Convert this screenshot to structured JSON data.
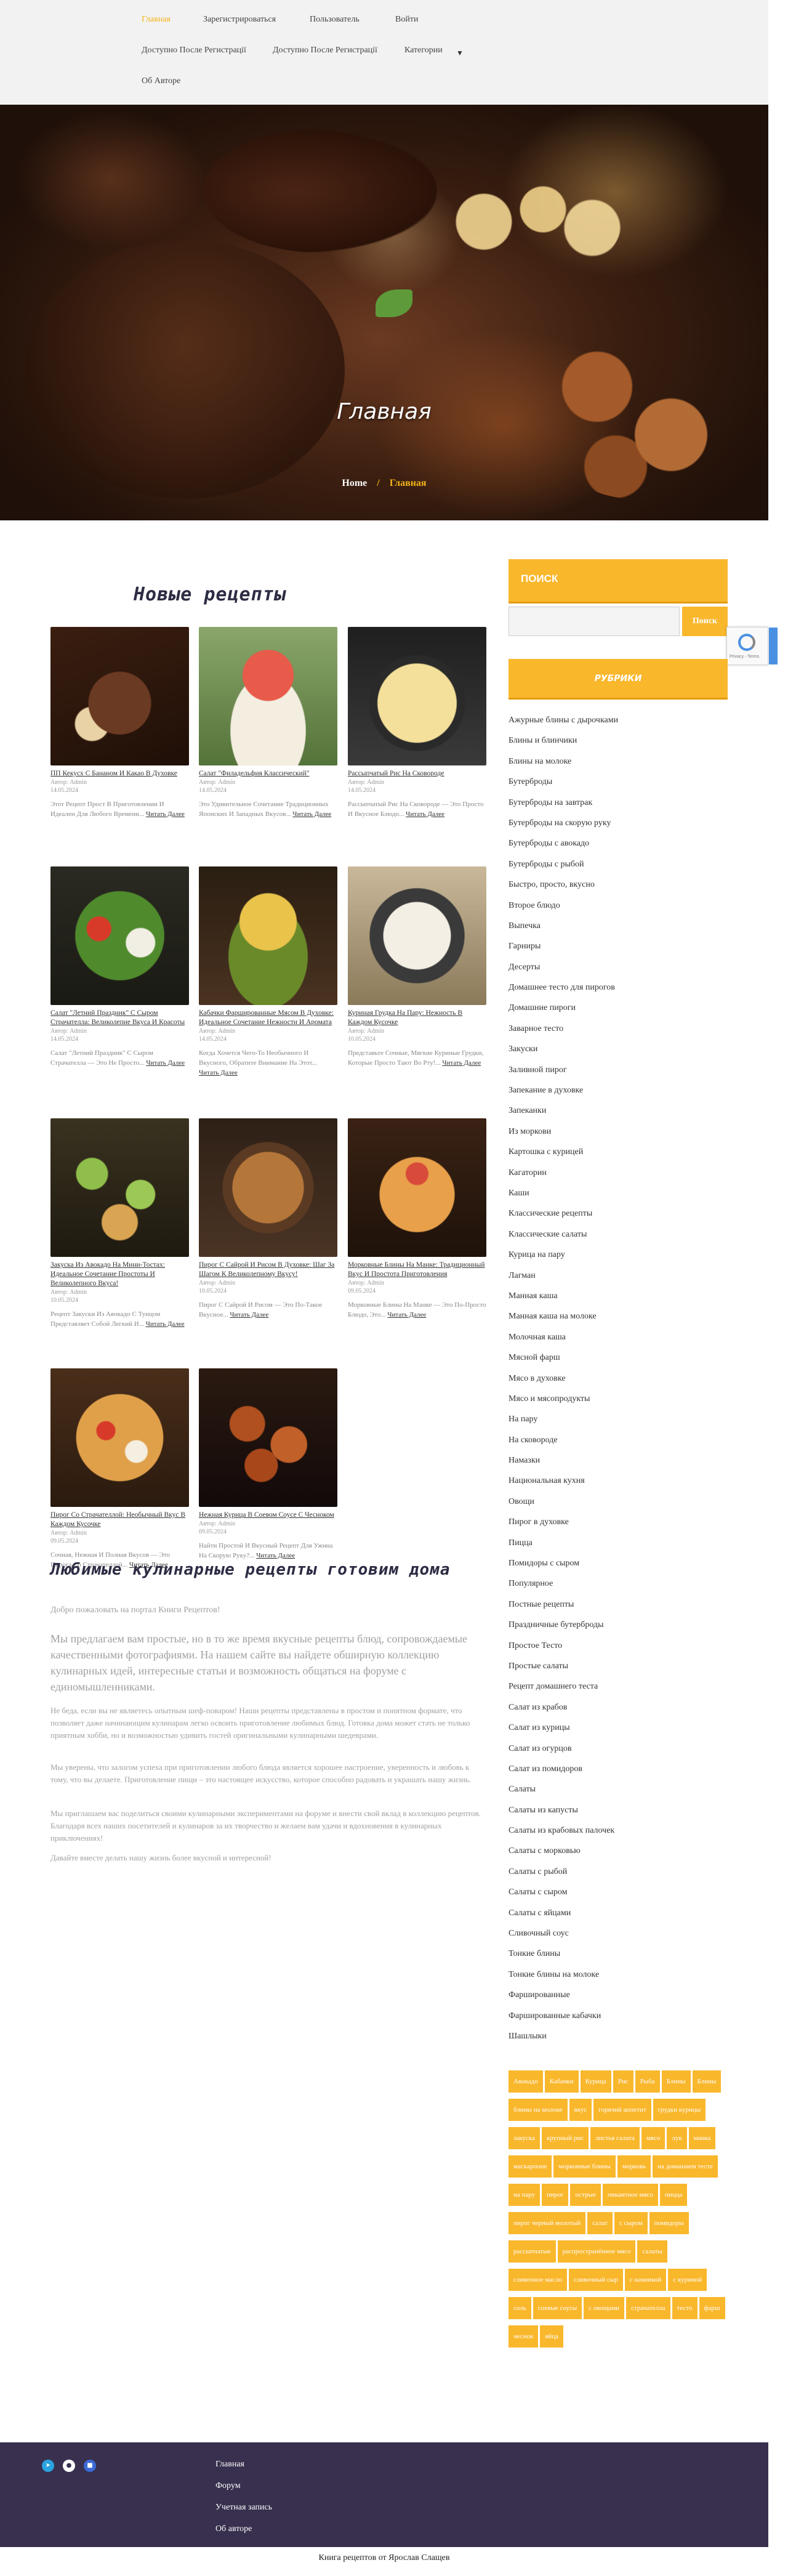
{
  "nav": {
    "items": [
      {
        "label": "Главная",
        "active": true
      },
      {
        "label": "Зарегистрироваться"
      },
      {
        "label": "Пользователь"
      },
      {
        "label": "Войти"
      },
      {
        "label": "Доступно После Регистрації"
      },
      {
        "label": "Доступно После Регистрації"
      },
      {
        "label": "Категории"
      },
      {
        "label": "Об Авторе"
      }
    ]
  },
  "hero": {
    "title": "Главная",
    "breadcrumb": {
      "home": "Home",
      "sep": "/",
      "current": "Главная"
    }
  },
  "main": {
    "new_title": "Новые рецепты",
    "recipes": [
      {
        "title": "ПП Кекусх С Бананом И Какао В Духовке",
        "author": "Автор: Admin",
        "date": "14.05.2024",
        "excerpt": "Этот Рецепт Прост В Приготовлении И Идеален Для Любого Времени...",
        "more": "Читать Далее",
        "img": "chocolate"
      },
      {
        "title": "Салат \"Филадельфия Классический\"",
        "author": "Автор: Admin",
        "date": "14.05.2024",
        "excerpt": "Это Удивительное Сочетание Традиционных Японских И Западных Вкусов...",
        "more": "Читать Далее",
        "img": "salmon-salad"
      },
      {
        "title": "Рассыпчатый Рис На Сковороде",
        "author": "Автор: Admin",
        "date": "14.05.2024",
        "excerpt": "Рассыпчатый Рис На Сковороде — Это Просто И Вкусное Блюдо...",
        "more": "Читать Далее",
        "img": "rice"
      },
      {
        "title": "Салат \"Летний Праздник\" С Сыром Страчателла: Великолепие Вкуса И Красоты",
        "author": "Автор: Admin",
        "date": "14.05.2024",
        "excerpt": "Салат \"Летний Праздник\" С Сыром Страчателла — Это Не Просто...",
        "more": "Читать Далее",
        "img": "summer-salad"
      },
      {
        "title": "Кабачки Фаршированные Мясом В Духовке: Идеальное Сочетание Нежности И Аромата",
        "author": "Автор: Admin",
        "date": "14.05.2024",
        "excerpt": "Когда Хочется Чего-То Необычного И Вкусного, Обратите Внимание На Этот...",
        "more": "Читать Далее",
        "img": "stuffed-zucchini"
      },
      {
        "title": "Куриная Грудка На Пару: Нежность В Каждом Кусочке",
        "author": "Автор: Admin",
        "date": "10.05.2024",
        "excerpt": "Представьте Сочные, Мягкие Куриные Грудки, Которые Просто Тают Во Рту!...",
        "more": "Читать Далее",
        "img": "chicken-breast"
      },
      {
        "title": "Закуска Из Авокадо На Мини-Тостах: Идеальное Сочетание Простоты И Великолепного Вкуса!",
        "author": "Автор: Admin",
        "date": "10.05.2024",
        "excerpt": "Рецепт Закуски Из Авокадо С Тунцом Представляет Собой Легкий И...",
        "more": "Читать Далее",
        "img": "avocado"
      },
      {
        "title": "Пирог С Сайрой И Рисом В Духовке: Шаг За Шагом К Великолепному Вкусу!",
        "author": "Автор: Admin",
        "date": "10.05.2024",
        "excerpt": "Пирог С Сайрой И Рисом — Это По-Такое Вкусное...",
        "more": "Читать Далее",
        "img": "fish-pie"
      },
      {
        "title": "Морковные Блины На Манке: Традиционный Вкус И Простота Приготовления",
        "author": "Автор: Admin",
        "date": "09.05.2024",
        "excerpt": "Морковные Блины На Манке — Это По-Просто Блюдо, Это...",
        "more": "Читать Далее",
        "img": "pancakes"
      },
      {
        "title": "Пирог Со Страчателлой: Необычный Вкус В Каждом Кусочке",
        "author": "Автор: Admin",
        "date": "09.05.2024",
        "excerpt": "Сочная, Нежная И Полная Вкусов — Это Пирога Со Страчателлой...",
        "more": "Читать Далее",
        "img": "pizza"
      },
      {
        "title": "Нежная Курица В Соевом Соусе С Чесноком",
        "author": "Автор: Admin",
        "date": "09.05.2024",
        "excerpt": "Найти Простой И Вкусный Рецепт Для Ужина На Скорую Руку?...",
        "more": "Читать Далее",
        "img": "soy-chicken"
      }
    ],
    "fav_title": "Любимые кулинарные рецепты готовим дома",
    "about": [
      "Добро пожаловать на портал Книги Рецептов!",
      "Мы предлагаем вам простые, но в то же время вкусные рецепты блюд, сопровождаемые качественными фотографиями. На нашем сайте вы найдете обширную коллекцию кулинарных идей, интересные статьи и возможность общаться на форуме с единомышленниками.",
      "Не беда, если вы не являетесь опытным шеф-поваром! Наши рецепты представлены в простом и понятном формате, что позволяет даже начинающим кулинарам легко освоить приготовление любимых блюд. Готовка дома может стать не только приятным хобби, но и возможностью удивить гостей оригинальными кулинарными шедеврами.",
      "Мы уверены, что залогом успеха при приготовлении любого блюда является хорошее настроение, уверенность и любовь к тому, что вы делаете. Приготовление пищи – это настоящее искусство, которое способно радовать и украшать нашу жизнь.",
      "Мы приглашаем вас поделиться своими кулинарными экспериментами на форуме и внести свой вклад в коллекцию рецептов. Благодаря всех наших посетителей и кулинаров за их творчество и желаем вам удачи и вдохновения в кулинарных приключениях!",
      "Давайте вместе делать нашу жизнь более вкусной и интересной!"
    ]
  },
  "sidebar": {
    "search_title": "ПОИСК",
    "search_placeholder": "",
    "search_button": "Поиск",
    "recaptcha_text": "Privacy - Terms",
    "categories_title": "РУБРИКИ",
    "categories": [
      "Ажурные блины с дырочками",
      "Блины и блинчики",
      "Блины на молоке",
      "Бутерброды",
      "Бутерброды на завтрак",
      "Бутерброды на скорую руку",
      "Бутерброды с авокадо",
      "Бутерброды с рыбой",
      "Быстро, просто, вкусно",
      "Второе блюдо",
      "Выпечка",
      "Гарниры",
      "Десерты",
      "Домашнее тесто для пирогов",
      "Домашние пироги",
      "Заварное тесто",
      "Закуски",
      "Заливной пирог",
      "Запекание в духовке",
      "Запеканки",
      "Из моркови",
      "Картошка с курицей",
      "Кагаторин",
      "Каши",
      "Классические рецепты",
      "Классические салаты",
      "Курица на пару",
      "Лагман",
      "Манная каша",
      "Манная каша на молоке",
      "Молочная каша",
      "Мясной фарш",
      "Мясо в духовке",
      "Мясо и мясопродукты",
      "На пару",
      "На сковороде",
      "Намазки",
      "Национальная кухня",
      "Овощи",
      "Пирог в духовке",
      "Пицца",
      "Помидоры с сыром",
      "Популярное",
      "Постные рецепты",
      "Праздничные бутерброды",
      "Простое Тесто",
      "Простые салаты",
      "Рецепт домашнего теста",
      "Салат из крабов",
      "Салат из курицы",
      "Салат из огурцов",
      "Салат из помидоров",
      "Салаты",
      "Салаты из капусты",
      "Салаты из крабовых палочек",
      "Салаты с морковью",
      "Салаты с рыбой",
      "Салаты с сыром",
      "Салаты с яйцами",
      "Сливочный соус",
      "Тонкие блины",
      "Тонкие блины на молоке",
      "Фаршированные",
      "Фаршированные кабачки",
      "Шашлыки"
    ],
    "tags": [
      "Авокадо",
      "Кабачки",
      "Курица",
      "Рис",
      "Рыба",
      "Блины",
      "Блины",
      "блины на молоке",
      "вкус",
      "горячий аппетит",
      "грудки курицы",
      "закуска",
      "крупный рис",
      "листья салата",
      "мясо",
      "лук",
      "манка",
      "маскарпоне",
      "морковные блины",
      "морковь",
      "на домашнем тесте",
      "на пару",
      "пирог",
      "острые",
      "пикантное мясо",
      "пицца",
      "пирог черный молотый",
      "салат",
      "с сыром",
      "помидоры",
      "рассыпчатые",
      "распространённое мясо",
      "салаты",
      "сливочное масло",
      "сливочный сыр",
      "с начинкой",
      "с куриной",
      "соль",
      "соевые соусы",
      "с овощами",
      "страчателла",
      "тесто",
      "фарш",
      "чеснок",
      "яйца"
    ]
  },
  "footer": {
    "links": [
      "Главная",
      "Форум",
      "Учетная запись",
      "Об авторе"
    ],
    "copyright": "Книга рецептов от Ярослав Слащев"
  }
}
